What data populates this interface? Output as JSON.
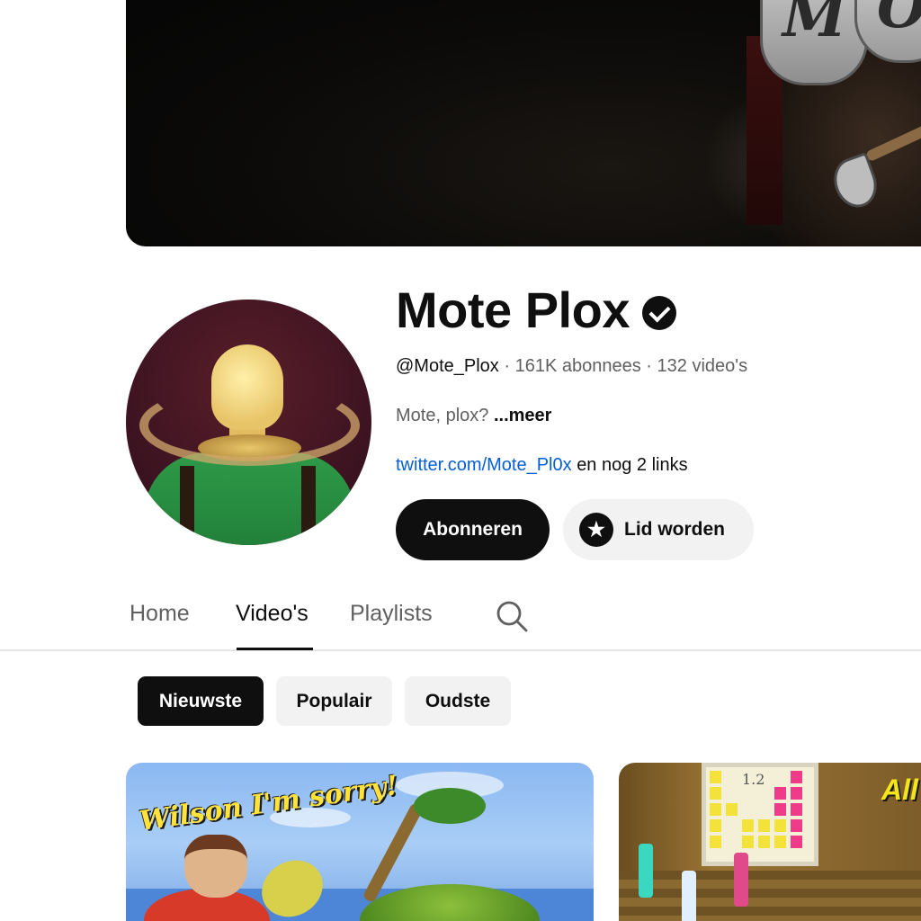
{
  "channel": {
    "name": "Mote Plox",
    "handle": "@Mote_Plox",
    "subscribers": "161K abonnees",
    "videos_count": "132 video's",
    "separator": "·",
    "description": "Mote, plox?",
    "more_label": "...meer",
    "link_text": "twitter.com/Mote_Pl0x",
    "more_links": "en nog 2 links",
    "verified_icon": "verified-check-icon"
  },
  "banner": {
    "logo_letters": "M",
    "logo_letters_2": "O"
  },
  "actions": {
    "subscribe_label": "Abonneren",
    "join_label": "Lid worden",
    "join_icon": "star-icon"
  },
  "tabs": [
    {
      "label": "Home",
      "active": false
    },
    {
      "label": "Video's",
      "active": true
    },
    {
      "label": "Playlists",
      "active": false
    }
  ],
  "chips": [
    {
      "label": "Nieuwste",
      "active": true
    },
    {
      "label": "Populair",
      "active": false
    },
    {
      "label": "Oudste",
      "active": false
    }
  ],
  "videos": [
    {
      "thumbnail_text": "Wilson I'm sorry!"
    },
    {
      "thumbnail_text": "All",
      "board_text": "1.2"
    }
  ],
  "colors": {
    "accent_black": "#0f0f0f",
    "link_blue": "#065fd4",
    "muted_text": "#606060",
    "chip_bg": "#f2f2f2"
  }
}
